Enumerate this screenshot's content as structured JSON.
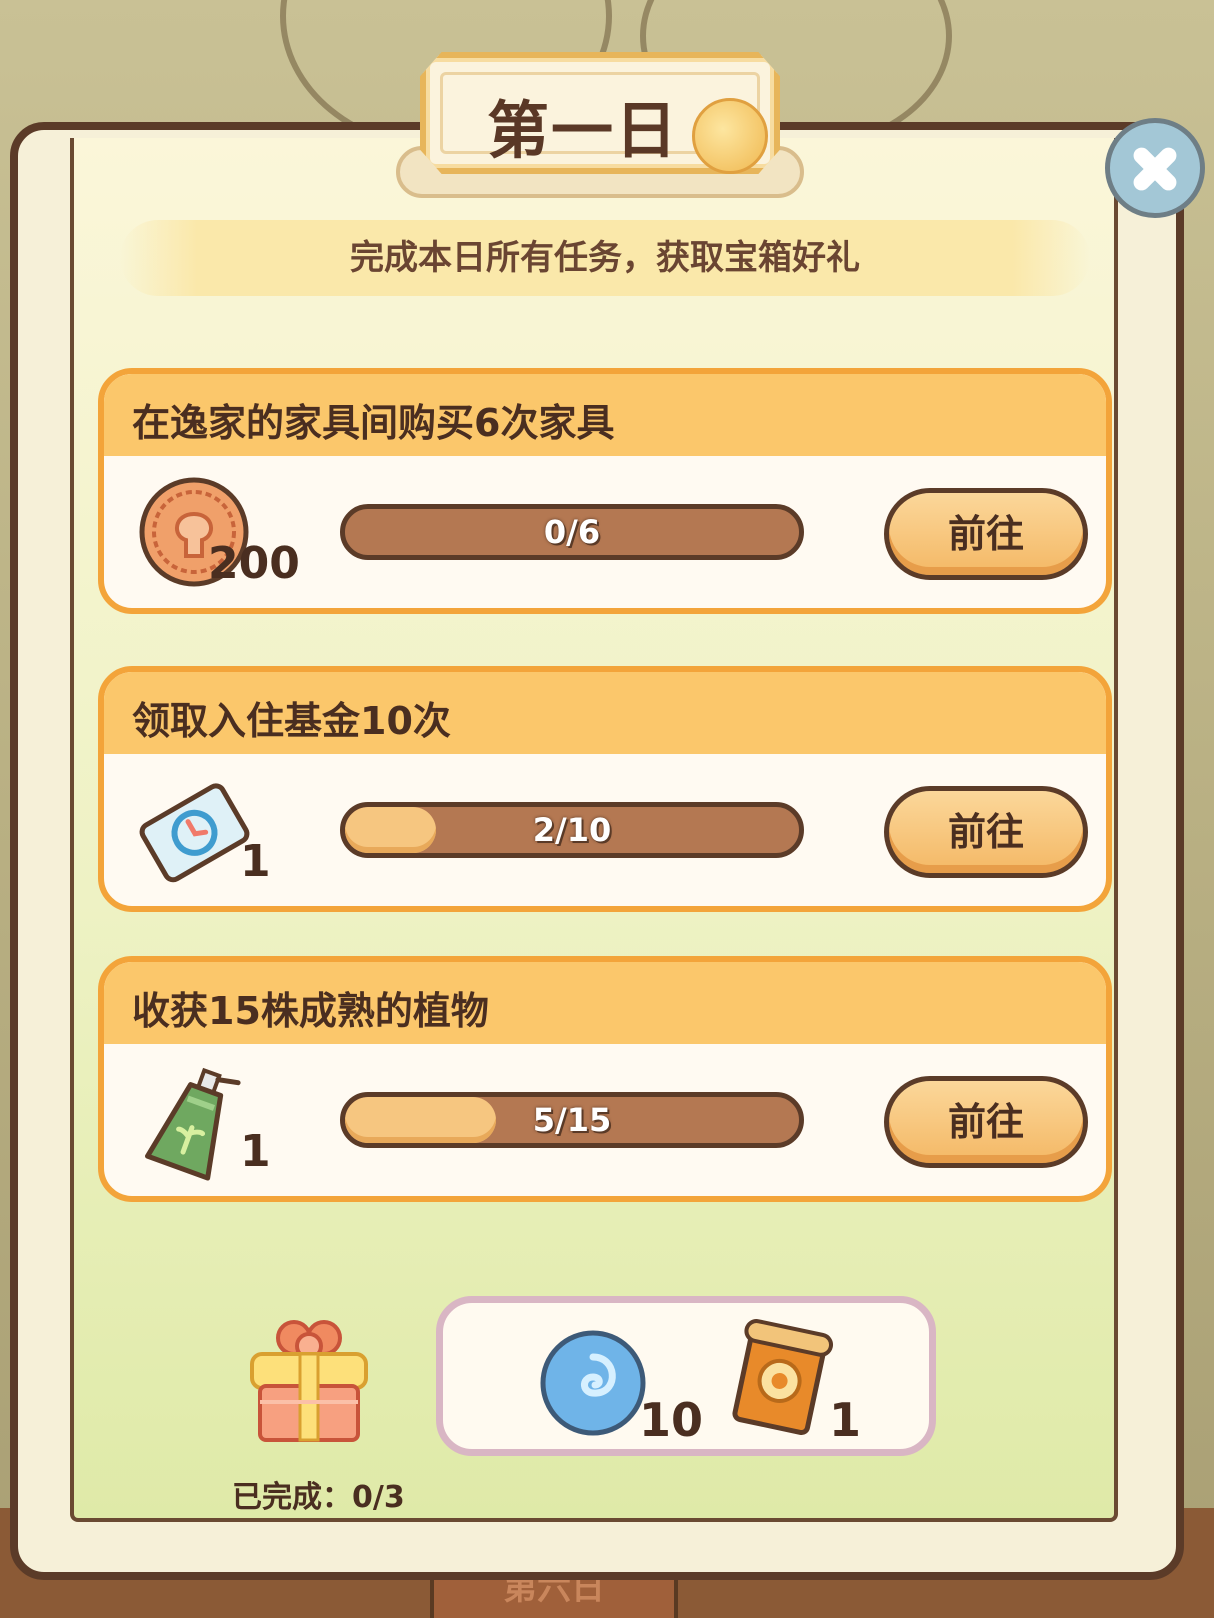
{
  "title": "第一日",
  "subtitle": "完成本日所有任务，获取宝箱好礼",
  "tasks": [
    {
      "name": "在逸家的家具间购买6次家具",
      "reward_icon": "coin-icon",
      "reward_count": "200",
      "progress_text": "0/6",
      "progress": 0.0,
      "button": "前往"
    },
    {
      "name": "领取入住基金10次",
      "reward_icon": "ticket-card-icon",
      "reward_count": "1",
      "progress_text": "2/10",
      "progress": 0.2,
      "button": "前往"
    },
    {
      "name": "收获15株成熟的植物",
      "reward_icon": "fertilizer-bottle-icon",
      "reward_count": "1",
      "progress_text": "5/15",
      "progress": 0.3333,
      "button": "前往"
    }
  ],
  "chest": {
    "completed_text": "已完成：0/3"
  },
  "chest_rewards": [
    {
      "icon": "blue-swirl-orb-icon",
      "count": "10"
    },
    {
      "icon": "scroll-card-icon",
      "count": "1"
    }
  ],
  "background_tab": "第六日",
  "colors": {
    "card_border": "#f3a43a",
    "card_header": "#fbc76b",
    "dark_brown": "#5b3b28",
    "progress_track": "#b47852",
    "progress_fill": "#f6c680"
  }
}
